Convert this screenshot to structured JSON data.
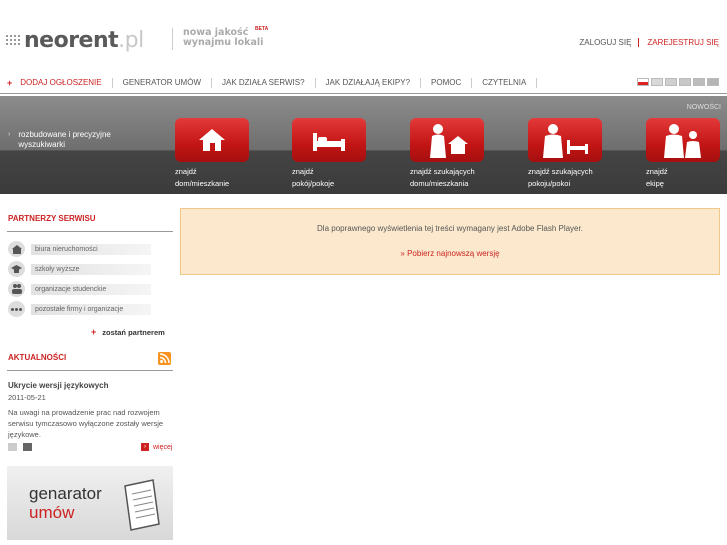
{
  "header": {
    "logo_main": "neorent",
    "logo_tld": ".pl",
    "slogan_line1": "nowa jakość",
    "slogan_line2": "wynajmu lokali",
    "beta": "BETA",
    "login": "ZALOGUJ SIĘ",
    "register": "ZAREJESTRUJ SIĘ"
  },
  "nav": {
    "items": [
      {
        "label": "DODAJ OGŁOSZENIE"
      },
      {
        "label": "GENERATOR UMÓW"
      },
      {
        "label": "JAK DZIAŁA SERWIS?"
      },
      {
        "label": "JAK DZIAŁAJĄ EKIPY?"
      },
      {
        "label": "POMOC"
      },
      {
        "label": "CZYTELNIA"
      }
    ],
    "flag_colors": [
      "#e0e0e0",
      "#d9d9d9",
      "#cfcfcf",
      "#c8c8c8",
      "#bdbdbd",
      "#b5b5b5"
    ]
  },
  "banner": {
    "news_label": "NOWOŚCI",
    "search_line1": "rozbudowane i precyzyjne",
    "search_line2": "wyszukiwarki",
    "tiles": [
      {
        "line1": "znajdź",
        "line2": "dom/mieszkanie",
        "icon": "house-icon"
      },
      {
        "line1": "znajdź",
        "line2": "pokój/pokoje",
        "icon": "bed-icon"
      },
      {
        "line1": "znajdź szukających",
        "line2": "domu/mieszkania",
        "icon": "person-house-icon"
      },
      {
        "line1": "znajdź szukających",
        "line2": "pokoju/pokoi",
        "icon": "person-bed-icon"
      },
      {
        "line1": "znajdź",
        "line2": "ekipę",
        "icon": "team-icon"
      }
    ]
  },
  "sidebar": {
    "partners_title": "PARTNERZY SERWISU",
    "partners": [
      {
        "label": "biura nieruchomości",
        "icon": "house-icon"
      },
      {
        "label": "szkoły wyższe",
        "icon": "graduation-cap-icon"
      },
      {
        "label": "organizacje studenckie",
        "icon": "people-icon"
      },
      {
        "label": "pozostałe firmy i organizacje",
        "icon": "more-dots-icon"
      }
    ],
    "become_partner": "zostań partnerem",
    "news_title": "AKTUALNOŚCI",
    "news": {
      "headline": "Ukrycie wersji językowych",
      "date": "2011-05-21",
      "text": "Na uwagi na prowadzenie prac nad rozwojem serwisu tymczasowo wyłączone zostały wersje językowe."
    },
    "more": "więcej",
    "generator_line1": "genarator",
    "generator_line2": "umów"
  },
  "flash": {
    "message": "Dla poprawnego wyświetlenia tej treści wymagany jest Adobe Flash Player.",
    "link": "» Pobierz najnowszą wersję"
  },
  "colors": {
    "accent": "#cc2222",
    "banner_dark": "#3b3b3b",
    "notice_bg": "#fce9cd"
  }
}
